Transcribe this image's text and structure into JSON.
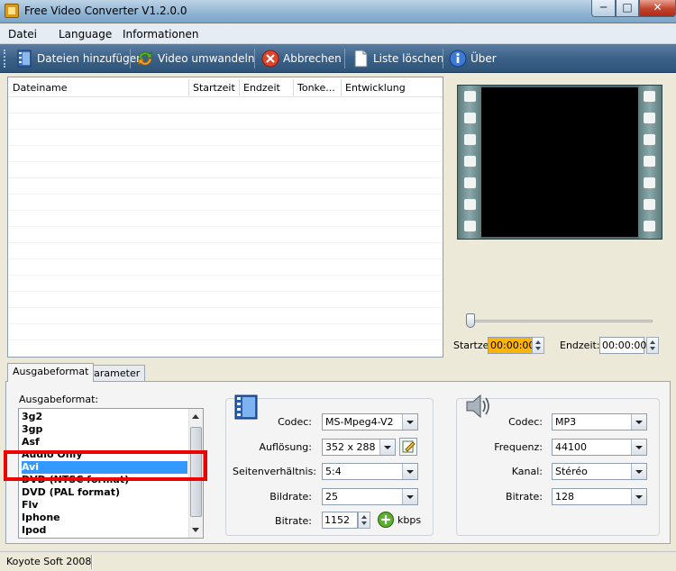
{
  "window": {
    "title": "Free Video Converter V1.2.0.0",
    "minimize": "─",
    "maximize": "□",
    "close": "✕"
  },
  "menu": {
    "items": [
      "Datei",
      "Language",
      "Informationen"
    ]
  },
  "toolbar": {
    "add_files": "Dateien hinzufügen",
    "convert": "Video umwandeln",
    "cancel": "Abbrechen",
    "clear_list": "Liste löschen",
    "about": "Über"
  },
  "file_list": {
    "columns": [
      "Dateiname",
      "Startzeit",
      "Endzeit",
      "Tonke...",
      "Entwicklung"
    ],
    "rows": []
  },
  "timing": {
    "start_label": "Startzei",
    "start_value": "00:00:00",
    "end_label": "Endzeit:",
    "end_value": "00:00:00",
    "start_highlight_color": "#ffb400"
  },
  "tabs": {
    "output_format": "Ausgabeformat",
    "parameters": "Parameter"
  },
  "output": {
    "label": "Ausgabeformat:",
    "formats": [
      "3g2",
      "3gp",
      "Asf",
      "Audio Only",
      "Avi",
      "DVD (NTSC format)",
      "DVD (PAL format)",
      "Flv",
      "Iphone",
      "Ipod"
    ],
    "selected": "Avi",
    "highlight_color": "#ee0000"
  },
  "video": {
    "codec_label": "Codec:",
    "codec_value": "MS-Mpeg4-V2",
    "resolution_label": "Auflösung:",
    "resolution_value": "352 x 288",
    "aspect_label": "Seitenverhältnis:",
    "aspect_value": "5:4",
    "framerate_label": "Bildrate:",
    "framerate_value": "25",
    "bitrate_label": "Bitrate:",
    "bitrate_value": "1152",
    "bitrate_unit": "kbps"
  },
  "audio": {
    "codec_label": "Codec:",
    "codec_value": "MP3",
    "frequency_label": "Frequenz:",
    "frequency_value": "44100",
    "channel_label": "Kanal:",
    "channel_value": "Stéréo",
    "bitrate_label": "Bitrate:",
    "bitrate_value": "128"
  },
  "status": {
    "text": "Koyote Soft 2008"
  }
}
